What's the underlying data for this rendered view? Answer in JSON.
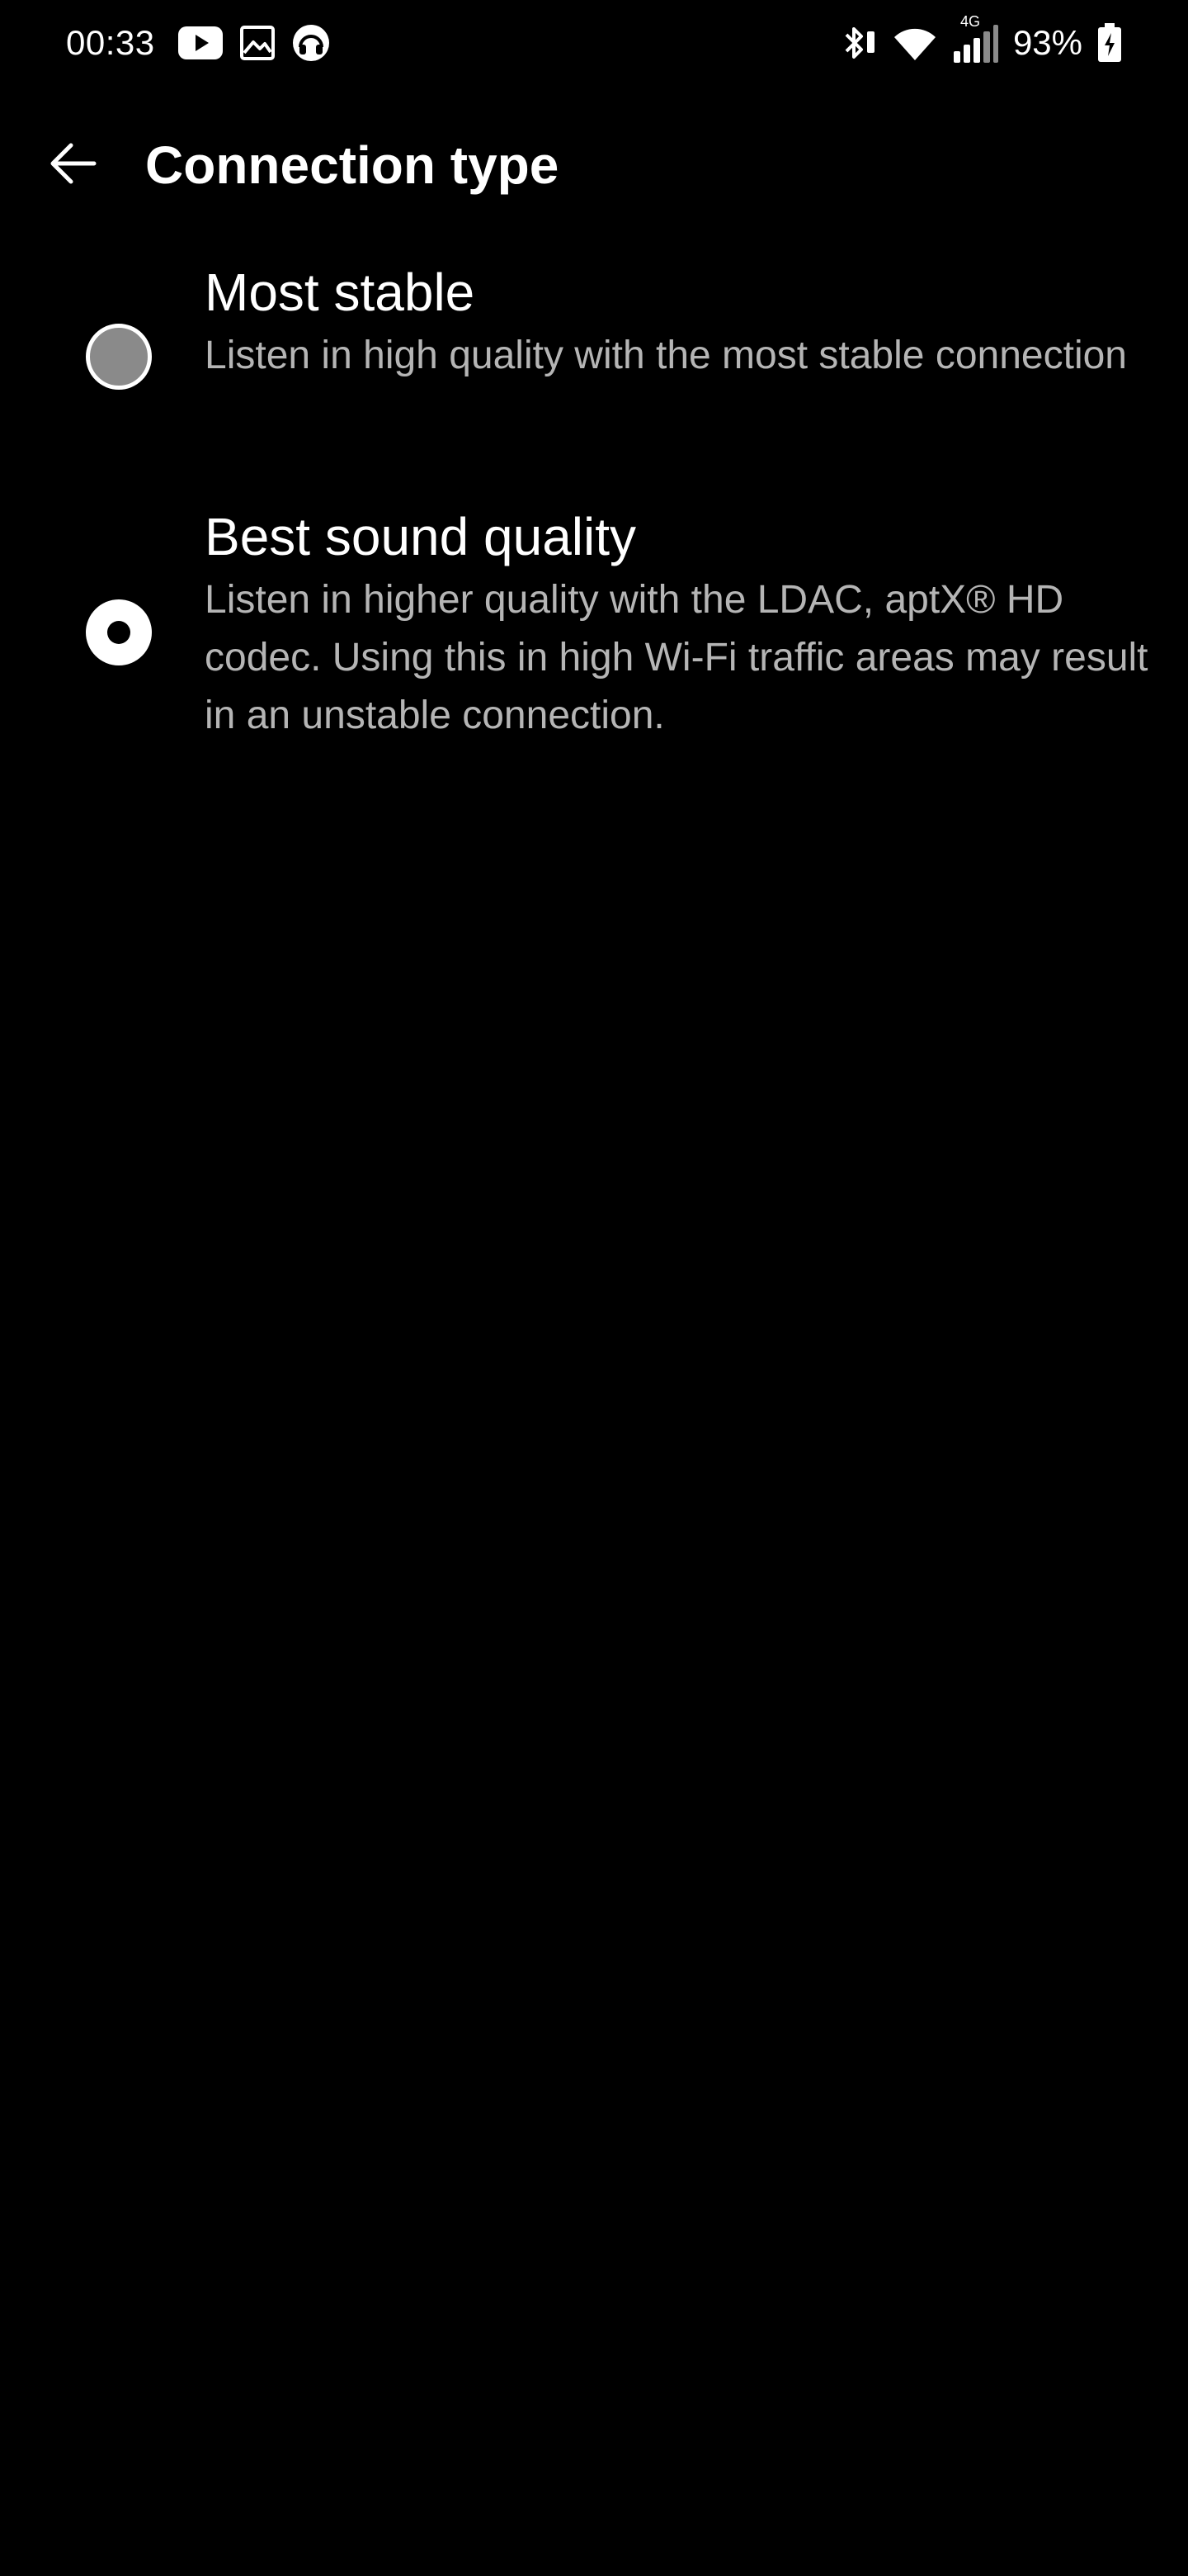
{
  "status_bar": {
    "time": "00:33",
    "network_type": "4G",
    "battery": "93%",
    "notification_icons": [
      "youtube-icon",
      "gallery-icon",
      "headphones-app-icon"
    ],
    "system_icons": [
      "bluetooth-icon",
      "wifi-icon",
      "cellular-signal-icon",
      "battery-charging-icon"
    ]
  },
  "app_bar": {
    "title": "Connection type",
    "back_icon": "arrow-left-icon"
  },
  "options": [
    {
      "title": "Most stable",
      "description": "Listen in high quality with the most stable connection",
      "selected": false
    },
    {
      "title": "Best sound quality",
      "description": "Listen in higher quality with the LDAC, aptX® HD codec. Using this in high Wi-Fi traffic areas may result in an unstable connection.",
      "selected": true
    }
  ],
  "colors": {
    "background": "#000000",
    "primary_text": "#ffffff",
    "secondary_text": "#b5b5b5",
    "radio_unselected_fill": "#8a8a8a",
    "radio_selected_fill": "#ffffff"
  }
}
